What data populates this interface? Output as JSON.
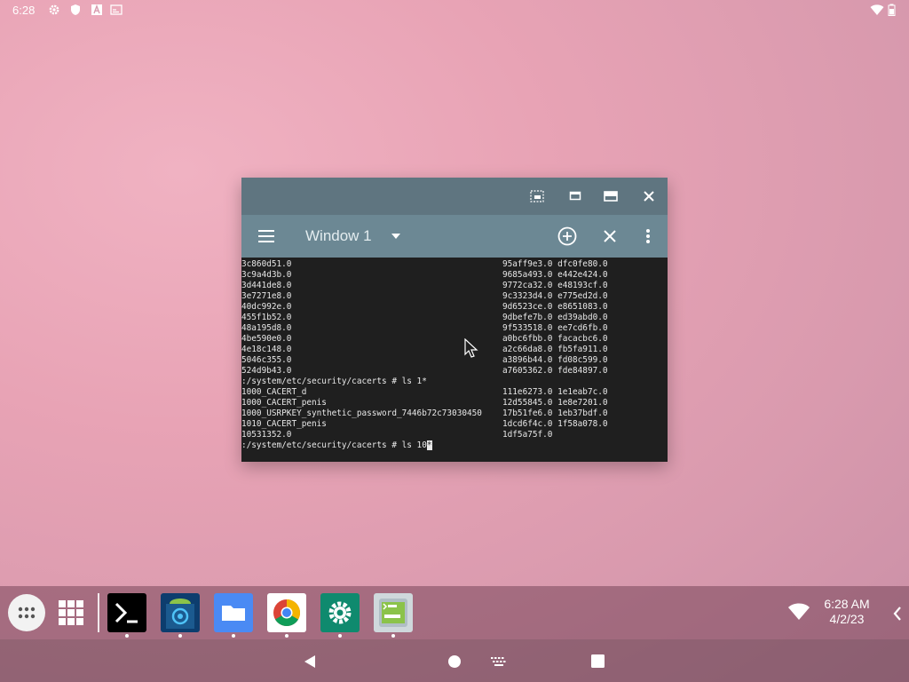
{
  "status_bar": {
    "time": "6:28",
    "left_icons": [
      "gear-icon",
      "shield-icon",
      "font-icon",
      "screen-icon"
    ],
    "right_icons": [
      "wifi-icon",
      "battery-icon"
    ]
  },
  "window": {
    "title": "Window 1",
    "caption_buttons": [
      "screenshot-icon",
      "restore-icon",
      "maximize-icon",
      "close-icon"
    ],
    "toolbar_actions": [
      "new-window-icon",
      "close-window-icon",
      "overflow-menu-icon"
    ]
  },
  "terminal": {
    "left_lines": [
      "3c860d51.0",
      "3c9a4d3b.0",
      "3d441de8.0",
      "3e7271e8.0",
      "40dc992e.0",
      "455f1b52.0",
      "48a195d8.0",
      "4be590e0.0",
      "4e18c148.0",
      "5046c355.0",
      "524d9b43.0",
      ":/system/etc/security/cacerts # ls 1*",
      "1000_CACERT_d",
      "1000_CACERT_penis",
      "1000_USRPKEY_synthetic_password_7446b72c73030450",
      "1010_CACERT_penis",
      "10531352.0",
      ":/system/etc/security/cacerts # ls 10"
    ],
    "right_lines": [
      "95aff9e3.0 dfc0fe80.0",
      "9685a493.0 e442e424.0",
      "9772ca32.0 e48193cf.0",
      "9c3323d4.0 e775ed2d.0",
      "9d6523ce.0 e8651083.0",
      "9dbefe7b.0 ed39abd0.0",
      "9f533518.0 ee7cd6fb.0",
      "a0bc6fbb.0 facacbc6.0",
      "a2c66da8.0 fb5fa911.0",
      "a3896b44.0 fd08c599.0",
      "a7605362.0 fde84897.0",
      "",
      "111e6273.0 1e1eab7c.0",
      "12d55845.0 1e8e7201.0",
      "17b51fe6.0 1eb37bdf.0",
      "1dcd6f4c.0 1f58a078.0",
      "1df5a75f.0"
    ],
    "cursor_char": "*"
  },
  "taskbar": {
    "apps": [
      {
        "name": "terminal-app",
        "icon": "terminal-icon",
        "color": "#000000"
      },
      {
        "name": "android-app",
        "icon": "android-icon",
        "color": "#0d3d6e"
      },
      {
        "name": "files-app",
        "icon": "folder-icon",
        "color": "#4a8af4"
      },
      {
        "name": "chrome-app",
        "icon": "chrome-icon",
        "color": "#ffffff"
      },
      {
        "name": "settings-app",
        "icon": "gear-icon",
        "color": "#0f8a6e"
      },
      {
        "name": "term-app",
        "icon": "term-icon",
        "color": "#cfd8dc"
      }
    ],
    "clock_time": "6:28 AM",
    "clock_date": "4/2/23"
  },
  "navbar": {
    "buttons": [
      "back-icon",
      "home-icon",
      "keyboard-icon",
      "recents-icon"
    ]
  }
}
